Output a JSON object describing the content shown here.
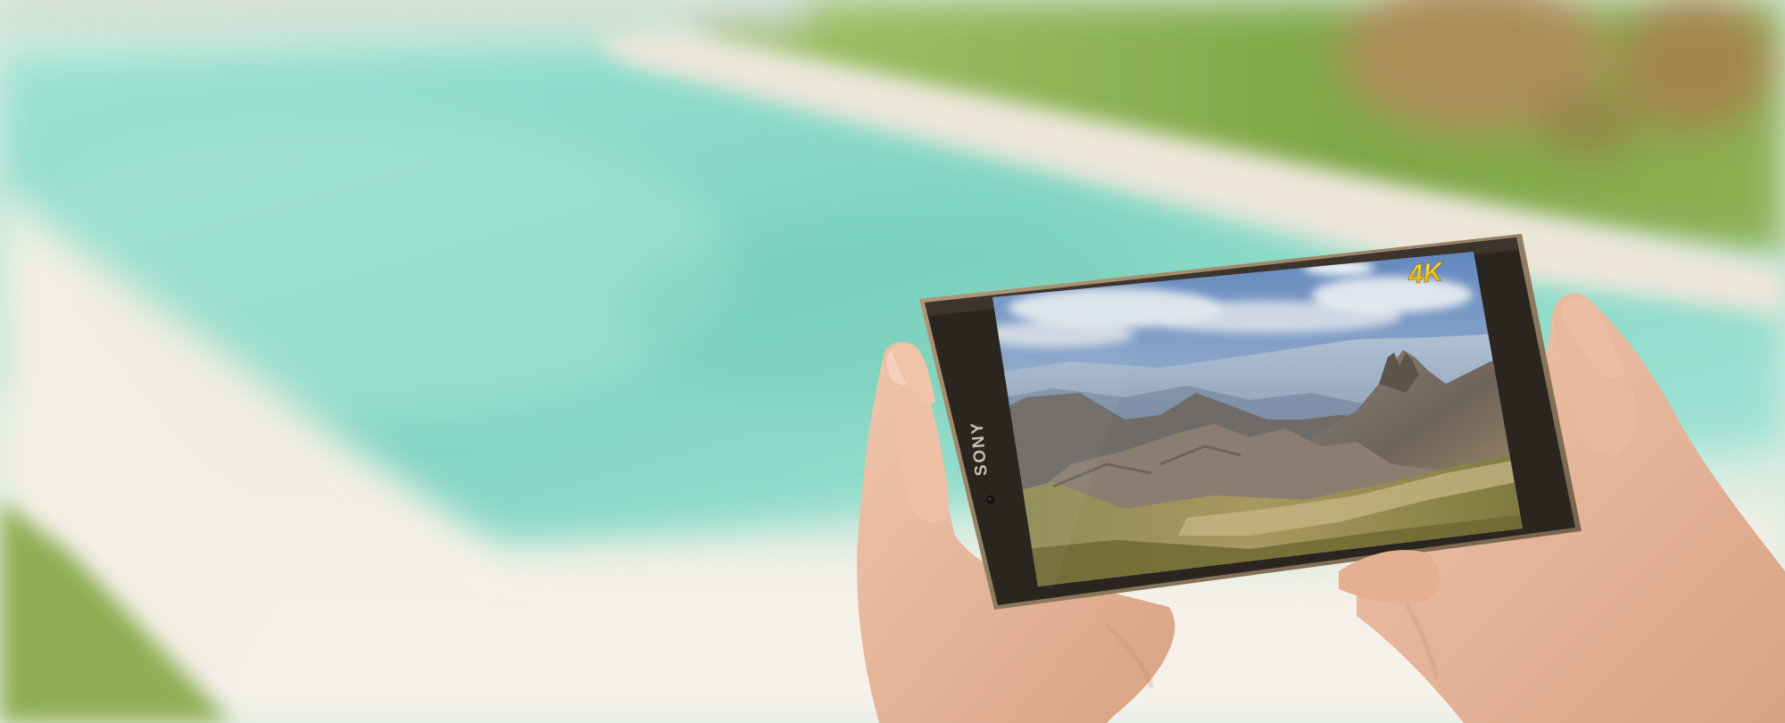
{
  "device": {
    "brand_label": "SONY",
    "screen_badge": "4K"
  },
  "colors": {
    "pool_water": "#8fdac6",
    "pool_deck": "#ece8dd",
    "grass": "#7fa84a",
    "phone_bezel": "#2a241f",
    "phone_frame": "#9c8566",
    "skin": "#e7b79f",
    "badge": "#f2c21b",
    "sky": "#7f9fc7"
  }
}
